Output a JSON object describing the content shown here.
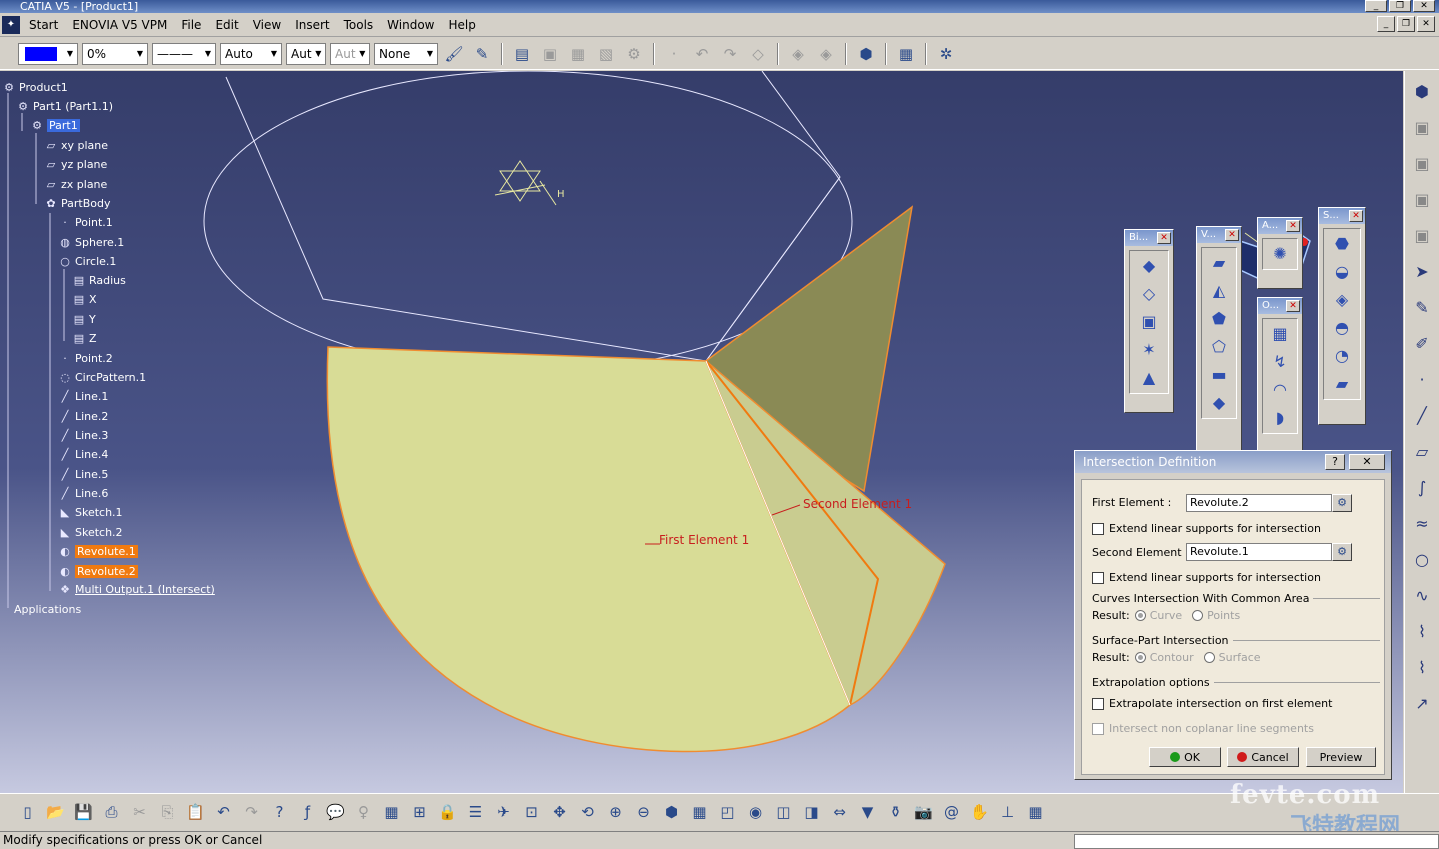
{
  "window": {
    "title": "CATIA V5 - [Product1]"
  },
  "menu": [
    "Start",
    "ENOVIA V5 VPM",
    "File",
    "Edit",
    "View",
    "Insert",
    "Tools",
    "Window",
    "Help"
  ],
  "toolbar": {
    "color": "#0000ff",
    "transparency": "0%",
    "linetype": "———",
    "thickness": "Auto",
    "point_style": "Aut",
    "point_style2": "Aut",
    "layer": "None"
  },
  "tree": {
    "items": [
      {
        "label": "Product1",
        "icon": "product-icon"
      },
      {
        "label": "Part1 (Part1.1)",
        "icon": "part-icon"
      },
      {
        "label": "Part1",
        "icon": "part-icon"
      },
      {
        "label": "xy plane",
        "icon": "plane-icon"
      },
      {
        "label": "yz plane",
        "icon": "plane-icon"
      },
      {
        "label": "zx plane",
        "icon": "plane-icon"
      },
      {
        "label": "PartBody",
        "icon": "body-icon"
      },
      {
        "label": "Point.1",
        "icon": "point-icon"
      },
      {
        "label": "Sphere.1",
        "icon": "sphere-icon"
      },
      {
        "label": "Circle.1",
        "icon": "circle-icon"
      },
      {
        "label": "Radius",
        "icon": "parameter-icon"
      },
      {
        "label": "X",
        "icon": "parameter-icon"
      },
      {
        "label": "Y",
        "icon": "parameter-icon"
      },
      {
        "label": "Z",
        "icon": "parameter-icon"
      },
      {
        "label": "Point.2",
        "icon": "point-icon"
      },
      {
        "label": "CircPattern.1",
        "icon": "pattern-icon"
      },
      {
        "label": "Line.1",
        "icon": "line-icon"
      },
      {
        "label": "Line.2",
        "icon": "line-icon"
      },
      {
        "label": "Line.3",
        "icon": "line-icon"
      },
      {
        "label": "Line.4",
        "icon": "line-icon"
      },
      {
        "label": "Line.5",
        "icon": "line-icon"
      },
      {
        "label": "Line.6",
        "icon": "line-icon"
      },
      {
        "label": "Sketch.1",
        "icon": "sketch-icon"
      },
      {
        "label": "Sketch.2",
        "icon": "sketch-icon"
      },
      {
        "label": "Revolute.1",
        "icon": "revolute-icon"
      },
      {
        "label": "Revolute.2",
        "icon": "revolute-icon"
      },
      {
        "label": "Multi Output.1 (Intersect)",
        "icon": "multi-output-icon"
      },
      {
        "label": "Applications",
        "icon": ""
      }
    ]
  },
  "viewport_labels": {
    "second_element": "Second Element 1",
    "first_element": "First Element 1",
    "axis_h": "H"
  },
  "palettes": [
    {
      "title": "Bi..."
    },
    {
      "title": "V..."
    },
    {
      "title": "A..."
    },
    {
      "title": "O..."
    },
    {
      "title": "S..."
    }
  ],
  "dialog": {
    "title": "Intersection Definition",
    "help": "?",
    "close": "✕",
    "first_element_label": "First Element :",
    "first_element_value": "Revolute.2",
    "extend1": "Extend linear supports for intersection",
    "second_element_label": "Second Element :",
    "second_element_value": "Revolute.1",
    "extend2": "Extend linear supports for intersection",
    "curves_section": "Curves Intersection With Common Area",
    "result_label": "Result:",
    "curve": "Curve",
    "points": "Points",
    "surface_section": "Surface-Part Intersection",
    "result_label2": "Result:",
    "contour": "Contour",
    "surface": "Surface",
    "extrapolation_section": "Extrapolation options",
    "extrapolate": "Extrapolate intersection on first element",
    "intersect_noncoplanar": "Intersect non coplanar line segments",
    "ok": "OK",
    "cancel": "Cancel",
    "preview": "Preview"
  },
  "status": {
    "message": "Modify specifications or press OK or Cancel"
  },
  "watermark": {
    "line1": "fevte.com",
    "line2": "飞特教程网"
  }
}
